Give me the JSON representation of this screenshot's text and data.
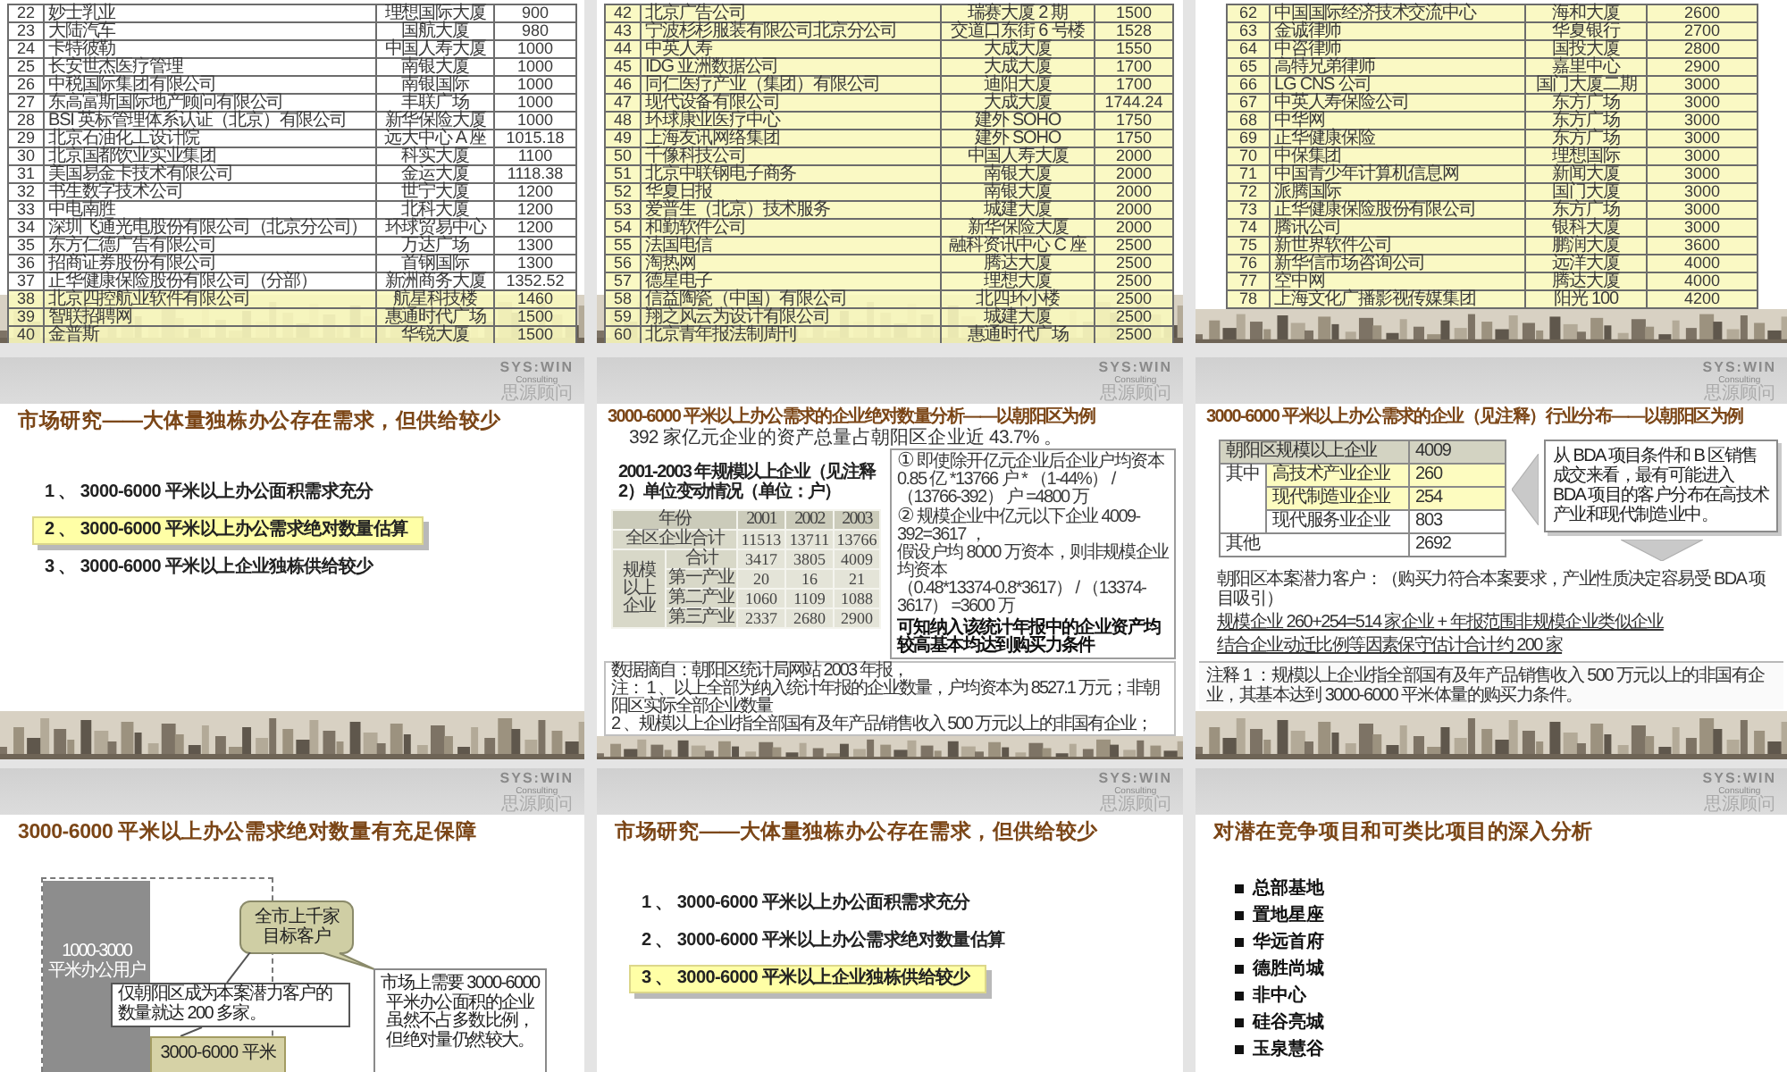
{
  "slides": [
    {
      "kind": "table",
      "rows": [
        {
          "no": "22",
          "company": "妙士乳业",
          "building": "理想国际大厦",
          "area": "900",
          "highlighted": false
        },
        {
          "no": "23",
          "company": "大陆汽车",
          "building": "国航大厦",
          "area": "980",
          "highlighted": false
        },
        {
          "no": "24",
          "company": "卡特彼勒",
          "building": "中国人寿大厦",
          "area": "1000",
          "highlighted": false
        },
        {
          "no": "25",
          "company": "长安世杰医疗管理",
          "building": "南银大厦",
          "area": "1000",
          "highlighted": false
        },
        {
          "no": "26",
          "company": "中税国际集团有限公司",
          "building": "南银国际",
          "area": "1000",
          "highlighted": false
        },
        {
          "no": "27",
          "company": "东高富斯国际地产顾问有限公司",
          "building": "丰联广场",
          "area": "1000",
          "highlighted": false
        },
        {
          "no": "28",
          "company": "BSI 英标管理体系认证（北京）有限公司",
          "building": "新华保险大厦",
          "area": "1000",
          "highlighted": false
        },
        {
          "no": "29",
          "company": "北京石油化工设计院",
          "building": "远大中心 A 座",
          "area": "1015.18",
          "highlighted": false
        },
        {
          "no": "30",
          "company": "北京国都饮业实业集团",
          "building": "科实大厦",
          "area": "1100",
          "highlighted": false
        },
        {
          "no": "31",
          "company": "美国易金卡技术有限公司",
          "building": "金运大厦",
          "area": "1118.38",
          "highlighted": false
        },
        {
          "no": "32",
          "company": "书生数字技术公司",
          "building": "世宁大厦",
          "area": "1200",
          "highlighted": false
        },
        {
          "no": "33",
          "company": "中电南胜",
          "building": "北科大厦",
          "area": "1200",
          "highlighted": false
        },
        {
          "no": "34",
          "company": "深圳飞通光电股份有限公司（北京分公司）",
          "building": "环球贸易中心",
          "area": "1200",
          "highlighted": false
        },
        {
          "no": "35",
          "company": "东方仁德广告有限公司",
          "building": "万达广场",
          "area": "1300",
          "highlighted": false
        },
        {
          "no": "36",
          "company": "招商证券股份有限公司",
          "building": "首钢国际",
          "area": "1300",
          "highlighted": false
        },
        {
          "no": "37",
          "company": "正华健康保险股份有限公司（分部）",
          "building": "新洲商务大厦",
          "area": "1352.52",
          "highlighted": false
        },
        {
          "no": "38",
          "company": "北京四控航业软件有限公司",
          "building": "航星科技楼",
          "area": "1460",
          "highlighted": true
        },
        {
          "no": "39",
          "company": "智联招聘网",
          "building": "惠通时代广场",
          "area": "1500",
          "highlighted": true
        },
        {
          "no": "40",
          "company": "金普斯",
          "building": "华锐大厦",
          "area": "1500",
          "highlighted": true
        }
      ]
    },
    {
      "kind": "table",
      "rows": [
        {
          "no": "42",
          "company": "北京广告公司",
          "building": "瑞赛大厦 2 期",
          "area": "1500",
          "highlighted": true
        },
        {
          "no": "43",
          "company": "宁波杉杉服装有限公司北京分公司",
          "building": "交道口东街 6 号楼",
          "area": "1528",
          "highlighted": true
        },
        {
          "no": "44",
          "company": "中英人寿",
          "building": "大成大厦",
          "area": "1550",
          "highlighted": true
        },
        {
          "no": "45",
          "company": "IDG 亚洲数据公司",
          "building": "大成大厦",
          "area": "1700",
          "highlighted": true
        },
        {
          "no": "46",
          "company": "同仁医疗产业（集团）有限公司",
          "building": "迪阳大厦",
          "area": "1700",
          "highlighted": true
        },
        {
          "no": "47",
          "company": "现代设备有限公司",
          "building": "大成大厦",
          "area": "1744.24",
          "highlighted": true
        },
        {
          "no": "48",
          "company": "环球康业医疗中心",
          "building": "建外 SOHO",
          "area": "1750",
          "highlighted": true
        },
        {
          "no": "49",
          "company": "上海友讯网络集团",
          "building": "建外 SOHO",
          "area": "1750",
          "highlighted": true
        },
        {
          "no": "50",
          "company": "千像科技公司",
          "building": "中国人寿大厦",
          "area": "2000",
          "highlighted": true
        },
        {
          "no": "51",
          "company": "北京中联钢电子商务",
          "building": "南银大厦",
          "area": "2000",
          "highlighted": true
        },
        {
          "no": "52",
          "company": "华夏日报",
          "building": "南银大厦",
          "area": "2000",
          "highlighted": true
        },
        {
          "no": "53",
          "company": "爱普生（北京）技术服务",
          "building": "城建大厦",
          "area": "2000",
          "highlighted": true
        },
        {
          "no": "54",
          "company": "和勤软件公司",
          "building": "新华保险大厦",
          "area": "2000",
          "highlighted": true
        },
        {
          "no": "55",
          "company": "法国电信",
          "building": "融科资讯中心 C 座",
          "area": "2500",
          "highlighted": true
        },
        {
          "no": "56",
          "company": "淘热网",
          "building": "腾达大厦",
          "area": "2500",
          "highlighted": true
        },
        {
          "no": "57",
          "company": "德星电子",
          "building": "理想大厦",
          "area": "2500",
          "highlighted": true
        },
        {
          "no": "58",
          "company": "信益陶瓷（中国）有限公司",
          "building": "北四环小楼",
          "area": "2500",
          "highlighted": true
        },
        {
          "no": "59",
          "company": "翔之风云为设计有限公司",
          "building": "城建大厦",
          "area": "2500",
          "highlighted": true
        },
        {
          "no": "60",
          "company": "北京青年报法制周刊",
          "building": "惠通时代广场",
          "area": "2500",
          "highlighted": true
        }
      ]
    },
    {
      "kind": "table",
      "rows": [
        {
          "no": "62",
          "company": "中国国际经济技术交流中心",
          "building": "海和大厦",
          "area": "2600",
          "highlighted": true
        },
        {
          "no": "63",
          "company": "金诚律师",
          "building": "华夏银行",
          "area": "2700",
          "highlighted": true
        },
        {
          "no": "64",
          "company": "中咨律师",
          "building": "国投大厦",
          "area": "2800",
          "highlighted": true
        },
        {
          "no": "65",
          "company": "高特兄弟律师",
          "building": "嘉里中心",
          "area": "2900",
          "highlighted": true
        },
        {
          "no": "66",
          "company": "LG CNS 公司",
          "building": "国门大厦二期",
          "area": "3000",
          "highlighted": true
        },
        {
          "no": "67",
          "company": "中英人寿保险公司",
          "building": "东方广场",
          "area": "3000",
          "highlighted": true
        },
        {
          "no": "68",
          "company": "中华网",
          "building": "东方广场",
          "area": "3000",
          "highlighted": true
        },
        {
          "no": "69",
          "company": "正华健康保险",
          "building": "东方广场",
          "area": "3000",
          "highlighted": true
        },
        {
          "no": "70",
          "company": "中保集团",
          "building": "理想国际",
          "area": "3000",
          "highlighted": true
        },
        {
          "no": "71",
          "company": "中国青少年计算机信息网",
          "building": "新闻大厦",
          "area": "3000",
          "highlighted": true
        },
        {
          "no": "72",
          "company": "派腾国际",
          "building": "国门大厦",
          "area": "3000",
          "highlighted": true
        },
        {
          "no": "73",
          "company": "正华健康保险股份有限公司",
          "building": "东方广场",
          "area": "3000",
          "highlighted": true
        },
        {
          "no": "74",
          "company": "腾讯公司",
          "building": "银科大厦",
          "area": "3000",
          "highlighted": true
        },
        {
          "no": "75",
          "company": "新世界软件公司",
          "building": "鹏润大厦",
          "area": "3600",
          "highlighted": true
        },
        {
          "no": "76",
          "company": "新华信市场咨询公司",
          "building": "远洋大厦",
          "area": "4000",
          "highlighted": true
        },
        {
          "no": "77",
          "company": "空中网",
          "building": "腾达大厦",
          "area": "4000",
          "highlighted": true
        },
        {
          "no": "78",
          "company": "上海文化广播影视传媒集团",
          "building": "阳光 100",
          "area": "4200",
          "highlighted": true
        }
      ]
    },
    {
      "kind": "agenda",
      "logo": {
        "wordmark": "SYS:WIN",
        "tagline": "Consulting",
        "subtitle": "思源顾问"
      },
      "title": "市场研究——大体量独栋办公存在需求，但供给较少",
      "items": [
        {
          "label": "1 、 3000-6000 平米以上办公面积需求充分",
          "highlighted": false
        },
        {
          "label": "2 、 3000-6000 平米以上办公需求绝对数量估算",
          "highlighted": true
        },
        {
          "label": "3 、 3000-6000 平米以上企业独栋供给较少",
          "highlighted": false
        }
      ]
    },
    {
      "kind": "analysis",
      "logo": {
        "wordmark": "SYS:WIN",
        "tagline": "Consulting",
        "subtitle": "思源顾问"
      },
      "title": "3000-6000 平米以上办公需求的企业绝对数量分析——以朝阳区为例",
      "subtitle": "392 家亿元企业的资产总量占朝阳区企业近 43.7% 。",
      "table": {
        "caption": "2001-2003 年规模以上企业（见注释 2）单位变动情况（单位：户）",
        "columns": [
          "年份",
          "2001",
          "2002",
          "2003"
        ],
        "total": {
          "label": "全区企业合计",
          "values": [
            "11513",
            "13711",
            "13766"
          ]
        },
        "group": "规模以上企业",
        "rows": [
          {
            "label": "合计",
            "values": [
              "3417",
              "3805",
              "4009"
            ]
          },
          {
            "label": "第一产业",
            "values": [
              "20",
              "16",
              "21"
            ]
          },
          {
            "label": "第二产业",
            "values": [
              "1060",
              "1109",
              "1088"
            ]
          },
          {
            "label": "第三产业",
            "values": [
              "2337",
              "2680",
              "2900"
            ]
          }
        ]
      },
      "calculation": [
        {
          "kind": "step",
          "marker": "①",
          "text": "即使除开亿元企业后企业户均资本"
        },
        {
          "kind": "formula",
          "text": "0.85 亿 *13766 户 * （1-44%） / （13766-392） 户 =4800 万"
        },
        {
          "kind": "step",
          "marker": "②",
          "text": "规模企业中亿元以下企业 4009-392=3617 ，"
        },
        {
          "kind": "formula",
          "text": "假设户均 8000 万资本，则非规模企业均资本"
        },
        {
          "kind": "formula",
          "text": "（0.48*13374-0.8*3617） / （13374-3617） =3600 万"
        },
        {
          "kind": "conclusion",
          "text": "可知纳入该统计年报中的企业资产均较高基本均达到购买力条件"
        }
      ],
      "notes": {
        "source": "数据摘自：朝阳区统计局网站 2003 年报，",
        "lines": [
          "注： 1 、以上全部为纳入统计年报的企业数量，户均资本为 8527.1 万元；非朝阳区实际全部企业数量",
          "2 、规模以上企业指全部国有及年产品销售收入 500 万元以上的非国有企业；"
        ]
      }
    },
    {
      "kind": "distribution",
      "logo": {
        "wordmark": "SYS:WIN",
        "tagline": "Consulting",
        "subtitle": "思源顾问"
      },
      "title": "3000-6000 平米以上办公需求的企业（见注释）行业分布——以朝阳区为例",
      "table": {
        "total": {
          "label": "朝阳区规模以上企业",
          "value": "4009"
        },
        "group": "其中",
        "rows": [
          {
            "label": "高技术产业企业",
            "value": "260",
            "highlighted": true
          },
          {
            "label": "现代制造业企业",
            "value": "254",
            "highlighted": true
          },
          {
            "label": "现代服务业企业",
            "value": "803",
            "highlighted": false
          }
        ],
        "other": {
          "label": "其他",
          "value": "2692"
        }
      },
      "callout": "从 BDA 项目条件和 B 区销售成交来看，最有可能进入 BDA 项目的客户分布在高技术产业和现代制造业中。",
      "findings": [
        {
          "text": "朝阳区本案潜力客户：（购买力符合本案要求，产业性质决定容易受 BDA 项目吸引）",
          "underlined": false
        },
        {
          "text": "规模企业 260+254=514 家企业 + 年报范围非规模企业类似企业",
          "underlined": true
        },
        {
          "text": "结合企业动迁比例等因素保守估计合计约 200 家",
          "underlined": true
        }
      ],
      "footnote": "注释 1 ：规模以上企业指全部国有及年产品销售收入 500 万元以上的非国有企业，其基本达到 3000-6000 平米体量的购买力条件。"
    },
    {
      "kind": "diagram",
      "logo": {
        "wordmark": "SYS:WIN",
        "tagline": "Consulting",
        "subtitle": "思源顾问"
      },
      "title": "3000-6000 平米以上办公需求绝对数量有充足保障",
      "diagram": {
        "bar_label": "1000-3000 平米办公用户",
        "bubble": "全市上千家目标客户",
        "callout": "仅朝阳区成为本案潜力客户的数量就达 200 多家。",
        "segment_label": "3000-6000 平米",
        "side_note": "市场上需要 3000-6000 平米办公面积的企业虽然不占多数比例，但绝对量仍然较大。"
      }
    },
    {
      "kind": "agenda",
      "logo": {
        "wordmark": "SYS:WIN",
        "tagline": "Consulting",
        "subtitle": "思源顾问"
      },
      "title": "市场研究——大体量独栋办公存在需求，但供给较少",
      "items": [
        {
          "label": "1 、 3000-6000 平米以上办公面积需求充分",
          "highlighted": false
        },
        {
          "label": "2 、 3000-6000 平米以上办公需求绝对数量估算",
          "highlighted": false
        },
        {
          "label": "3 、 3000-6000 平米以上企业独栋供给较少",
          "highlighted": true
        }
      ]
    },
    {
      "kind": "bullets",
      "logo": {
        "wordmark": "SYS:WIN",
        "tagline": "Consulting",
        "subtitle": "思源顾问"
      },
      "title": "对潜在竞争项目和可类比项目的深入分析",
      "items": [
        "总部基地",
        "置地星座",
        "华远首府",
        "德胜尚城",
        "非中心",
        "硅谷亮城",
        "玉泉慧谷"
      ]
    }
  ]
}
